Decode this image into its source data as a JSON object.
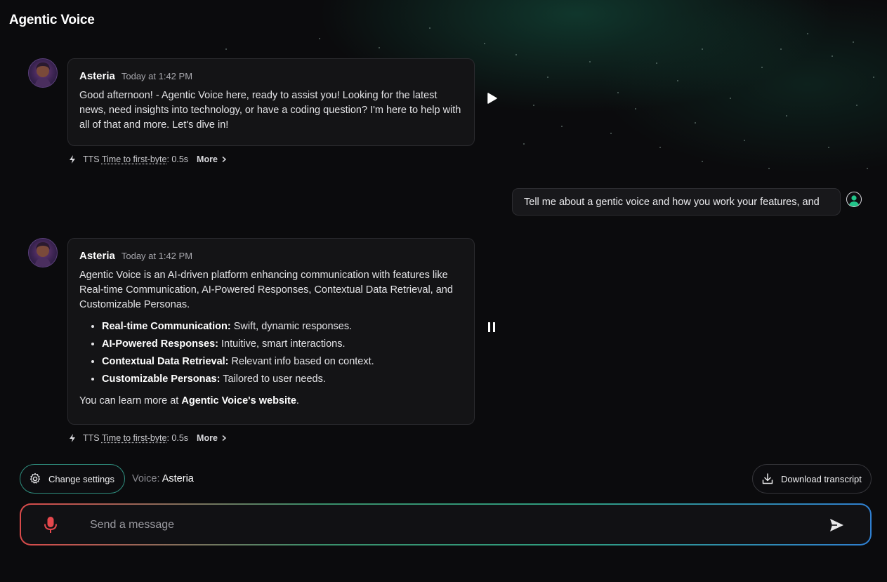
{
  "app": {
    "title": "Agentic Voice"
  },
  "messages": [
    {
      "sender": "Asteria",
      "time": "Today at 1:42 PM",
      "text": "Good afternoon! - Agentic Voice here, ready to assist you! Looking for the latest news, need insights into technology, or have a coding question? I'm here to help with all of that and more. Let's dive in!",
      "audio_control": "play-icon",
      "tts": {
        "prefix": "TTS",
        "metric": "Time to first-byte",
        "value": ": 0.5s",
        "more": "More"
      }
    },
    {
      "sender": "user",
      "text": "Tell me about a gentic voice and how you work your features, and"
    },
    {
      "sender": "Asteria",
      "time": "Today at 1:42 PM",
      "intro": "Agentic Voice is an AI-driven platform enhancing communication with features like Real-time Communication, AI-Powered Responses, Contextual Data Retrieval, and Customizable Personas.",
      "features": [
        {
          "name": "Real-time Communication:",
          "desc": " Swift, dynamic responses."
        },
        {
          "name": "AI-Powered Responses:",
          "desc": " Intuitive, smart interactions."
        },
        {
          "name": "Contextual Data Retrieval:",
          "desc": " Relevant info based on context."
        },
        {
          "name": "Customizable Personas:",
          "desc": " Tailored to user needs."
        }
      ],
      "outro_prefix": "You can learn more at ",
      "outro_link": "Agentic Voice's website",
      "outro_suffix": ".",
      "audio_control": "pause-icon",
      "tts": {
        "prefix": "TTS",
        "metric": "Time to first-byte",
        "value": ": 0.5s",
        "more": "More"
      }
    }
  ],
  "controls": {
    "settings_label": "Change settings",
    "voice_prefix": "Voice:",
    "voice_name": "Asteria",
    "download_label": "Download transcript"
  },
  "composer": {
    "placeholder": "Send a message",
    "value": ""
  },
  "colors": {
    "background": "#0b0b0d",
    "bubble": "#141416",
    "mic_red": "#e5484d",
    "accent_teal": "#2f9d80",
    "accent_blue": "#2f7fd0"
  }
}
